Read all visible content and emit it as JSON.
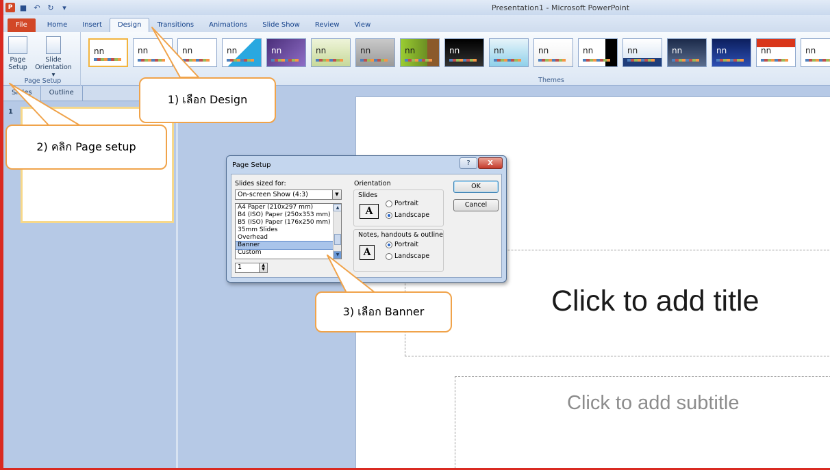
{
  "app": {
    "window_title": "Presentation1 - Microsoft PowerPoint",
    "logo_letter": "P"
  },
  "ribbon": {
    "tabs": [
      "File",
      "Home",
      "Insert",
      "Design",
      "Transitions",
      "Animations",
      "Slide Show",
      "Review",
      "View"
    ],
    "active_tab": "Design",
    "page_setup_button": "Page Setup",
    "page_setup_line1": "Page",
    "page_setup_line2": "Setup",
    "orientation_line1": "Slide",
    "orientation_line2": "Orientation ▾",
    "group_page_setup": "Page Setup",
    "group_themes": "Themes",
    "theme_sample_text": "nn",
    "theme_count": 17
  },
  "left_pane": {
    "tabs": [
      "Slides",
      "Outline"
    ],
    "slide_number": "1"
  },
  "slide": {
    "title_placeholder": "Click to add title",
    "subtitle_placeholder": "Click to add subtitle"
  },
  "dialog": {
    "title": "Page Setup",
    "help": "?",
    "close": "X",
    "sized_for_label": "Slides sized for:",
    "selected_size": "On-screen Show (4:3)",
    "size_options": [
      "A4 Paper (210x297 mm)",
      "B4 (ISO) Paper (250x353 mm)",
      "B5 (ISO) Paper (176x250 mm)",
      "35mm Slides",
      "Overhead",
      "Banner",
      "Custom"
    ],
    "highlighted_option": "Banner",
    "spin_value": "1",
    "orientation_label": "Orientation",
    "slides_label": "Slides",
    "notes_label": "Notes, handouts & outline",
    "portrait": "Portrait",
    "landscape": "Landscape",
    "ok": "OK",
    "cancel": "Cancel",
    "slides_orientation": "Landscape",
    "notes_orientation": "Portrait"
  },
  "callouts": {
    "step1": "1) เลือก  Design",
    "step2": "2) คลิก  Page setup",
    "step3": "3) เลือก Banner"
  },
  "colors": {
    "accent_red": "#d92a21",
    "callout_border": "#f0a34a",
    "ribbon_blue": "#b6c9e6"
  }
}
